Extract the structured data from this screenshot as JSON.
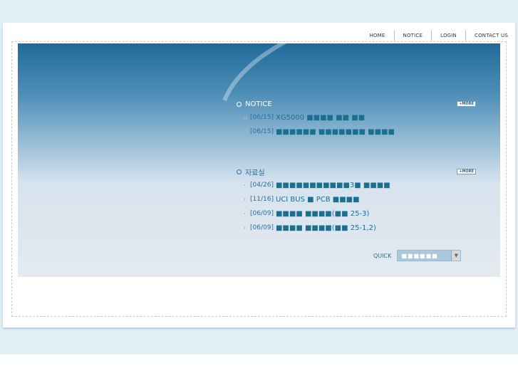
{
  "nav": {
    "items": [
      {
        "label": "HOME"
      },
      {
        "label": "NOTICE"
      },
      {
        "label": "LOGIN"
      },
      {
        "label": "CONTACT US"
      }
    ]
  },
  "notice": {
    "title": "NOTICE",
    "more_label": "+MORE",
    "items": [
      {
        "date": "[06/15]",
        "title": "XG5000 ■■■■ ■■ ■■"
      },
      {
        "date": "[06/15]",
        "title": "■■■■■■ ■■■■■■■ ■■■■"
      }
    ]
  },
  "archive": {
    "title": "자료실",
    "more_label": "+MORE",
    "items": [
      {
        "date": "[04/26]",
        "title": "■■■■■■■■■■■3■ ■■■■"
      },
      {
        "date": "[11/16]",
        "title": "UCI BUS ■ PCB ■■■■"
      },
      {
        "date": "[06/09]",
        "title": "■■■■ ■■■■(■■ 25-3)"
      },
      {
        "date": "[06/09]",
        "title": "■■■■ ■■■■(■■ 25-1,2)"
      }
    ]
  },
  "quick": {
    "label": "QUICK",
    "selected": "■■■■■■"
  },
  "colors": {
    "accent": "#1a7090",
    "hero_top": "#1f6a99",
    "hero_bottom": "#e4eaf0"
  }
}
